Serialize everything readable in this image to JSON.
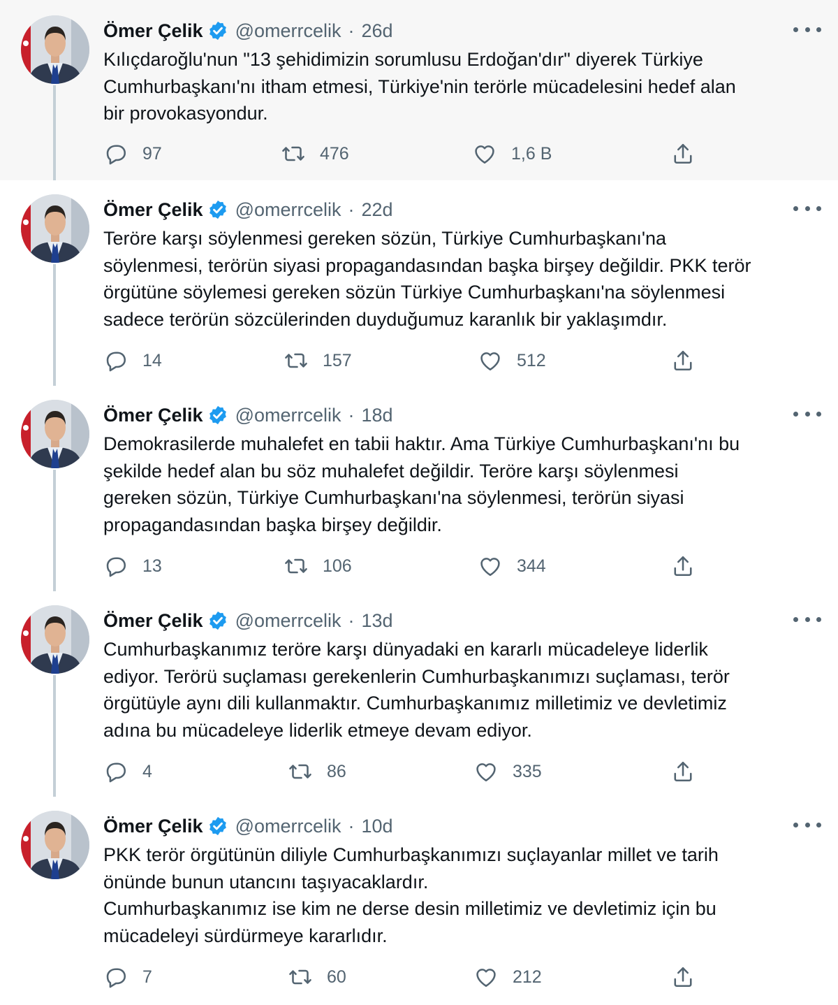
{
  "colors": {
    "verified": "#1d9bf0",
    "icon": "#536471",
    "thread_line": "#c4cfd6",
    "highlight_bg": "#f7f7f7"
  },
  "icons": {
    "reply": "reply-icon",
    "retweet": "retweet-icon",
    "like": "heart-icon",
    "share": "share-icon",
    "verified": "verified-badge-icon",
    "more": "more-icon"
  },
  "tweets": [
    {
      "name": "Ömer Çelik",
      "handle": "@omerrcelik",
      "dot": "·",
      "time": "26d",
      "text": "Kılıçdaroğlu'nun \"13 şehidimizin sorumlusu Erdoğan'dır\" diyerek Türkiye\nCumhurbaşkanı'nı itham etmesi, Türkiye'nin terörle mücadelesini hedef alan\nbir provokasyondur.",
      "replies": "97",
      "retweets": "476",
      "likes": "1,6 B"
    },
    {
      "name": "Ömer Çelik",
      "handle": "@omerrcelik",
      "dot": "·",
      "time": "22d",
      "text": "Teröre karşı söylenmesi gereken sözün, Türkiye Cumhurbaşkanı'na\nsöylenmesi, terörün siyasi propagandasından başka birşey değildir. PKK terör\nörgütüne söylemesi gereken sözün Türkiye Cumhurbaşkanı'na söylenmesi\nsadece terörün sözcülerinden duyduğumuz karanlık bir yaklaşımdır.",
      "replies": "14",
      "retweets": "157",
      "likes": "512"
    },
    {
      "name": "Ömer Çelik",
      "handle": "@omerrcelik",
      "dot": "·",
      "time": "18d",
      "text": "Demokrasilerde muhalefet en tabii haktır. Ama Türkiye Cumhurbaşkanı'nı bu\nşekilde hedef alan bu söz muhalefet değildir. Teröre karşı söylenmesi\ngereken sözün, Türkiye Cumhurbaşkanı'na söylenmesi, terörün siyasi\npropagandasından başka birşey değildir.",
      "replies": "13",
      "retweets": "106",
      "likes": "344"
    },
    {
      "name": "Ömer Çelik",
      "handle": "@omerrcelik",
      "dot": "·",
      "time": "13d",
      "text": "Cumhurbaşkanımız teröre karşı dünyadaki en kararlı mücadeleye liderlik\nediyor. Terörü suçlaması gerekenlerin Cumhurbaşkanımızı suçlaması, terör\nörgütüyle aynı dili kullanmaktır. Cumhurbaşkanımız milletimiz ve devletimiz\nadına bu mücadeleye liderlik etmeye devam ediyor.",
      "replies": "4",
      "retweets": "86",
      "likes": "335"
    },
    {
      "name": "Ömer Çelik",
      "handle": "@omerrcelik",
      "dot": "·",
      "time": "10d",
      "text": "PKK terör örgütünün diliyle Cumhurbaşkanımızı suçlayanlar millet ve tarih\nönünde bunun utancını taşıyacaklardır.\nCumhurbaşkanımız ise kim ne derse desin milletimiz ve devletimiz için bu\nmücadeleyi sürdürmeye kararlıdır.",
      "replies": "7",
      "retweets": "60",
      "likes": "212"
    }
  ]
}
